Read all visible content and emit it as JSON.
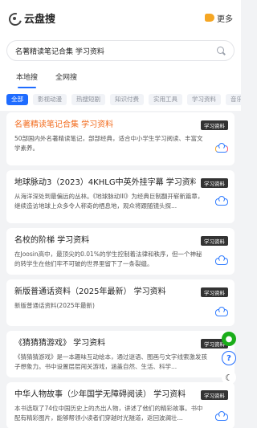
{
  "header": {
    "title": "云盘搜",
    "more_label": "更多"
  },
  "search": {
    "value": "名著精读笔记合集 学习资料",
    "placeholder": ""
  },
  "tabs": [
    {
      "label": "本地搜",
      "active": true
    },
    {
      "label": "全网搜",
      "active": false
    }
  ],
  "chips": [
    {
      "label": "全部",
      "active": true
    },
    {
      "label": "影视动漫"
    },
    {
      "label": "热搜短剧"
    },
    {
      "label": "知识付费"
    },
    {
      "label": "实用工具"
    },
    {
      "label": "学习资料"
    },
    {
      "label": "音乐"
    }
  ],
  "results": [
    {
      "title": "名著精读笔记合集 学习资料",
      "highlight": true,
      "desc": "50部国内外名著精读笔记，部部经典，适合中小学生学习阅读、丰富文学素养。",
      "badge": "学习资料",
      "cloud": "multi"
    },
    {
      "title": "地球脉动3（2023）4KHLG中英外挂字幕 学习资料",
      "highlight": false,
      "desc": "从海洋深处到最偏远的丛林。《地球脉动III》为经典巨制翻开崭新篇章，继续造访地球上众多令人称奇的栖息地，观众将跟随镜头探...",
      "badge": "学习资料",
      "cloud": "blue"
    },
    {
      "title": "名校的阶梯 学习资料",
      "highlight": false,
      "desc": "在Joosin高中，最顶尖的0.01%的学生控制着法律和秩序，但一个神秘的转学生在他们牢不可破的世界里留下了一条裂缝。",
      "badge": "学习资料",
      "cloud": "blue"
    },
    {
      "title": "新版普通话资料（2025年最新） 学习资料",
      "highlight": false,
      "desc": "新版普通话资料(2025年最新)",
      "badge": "学习资料",
      "cloud": "blue"
    },
    {
      "title": "《猜猜猜游戏》 学习资料",
      "highlight": false,
      "desc": "《猜猜猜游戏》是一本趣味互动绘本，通过谜语、图画与文字线索激发孩子想象力。书中设置层层闯关游戏，涵盖自然、生活、科学...",
      "badge": "学习资料",
      "cloud": "blue"
    },
    {
      "title": "中华人物故事（少年国学无障碍阅读） 学习资料",
      "highlight": false,
      "desc": "本书选取了74位中国历史上的杰出人物，讲述了他们的精彩故事。书中配有精彩图片，能够帮领小读者们穿越时光隧道，返回波澜壮...",
      "badge": "学习资料",
      "cloud": "blue"
    }
  ],
  "icons": {
    "logo": "cloud-search-logo-icon",
    "more": "hand-point-icon",
    "search": "search-icon",
    "wechat": "wechat-icon",
    "help": "question-icon",
    "theme": "moon-icon"
  },
  "colors": {
    "accent": "#1f6cff",
    "highlight_title": "#f26b1d",
    "badge_bg": "#333333"
  }
}
